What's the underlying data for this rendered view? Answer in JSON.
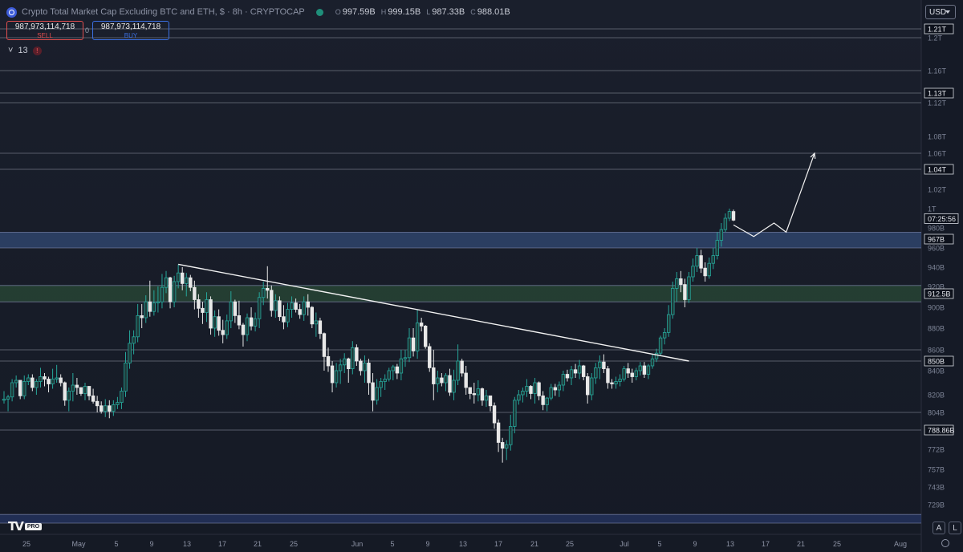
{
  "header": {
    "title": "Crypto Total Market Cap Excluding BTC and ETH, $ · 8h · CRYPTOCAP",
    "ohlc": [
      {
        "label": "O",
        "value": "997.59B"
      },
      {
        "label": "H",
        "value": "999.15B"
      },
      {
        "label": "L",
        "value": "987.33B"
      },
      {
        "label": "C",
        "value": "988.01B"
      }
    ],
    "currency": "USD"
  },
  "trade": {
    "sell_price": "987,973,114,718",
    "sell_label": "SELL",
    "buy_price": "987,973,114,718",
    "buy_label": "BUY",
    "spread": "0"
  },
  "indicator": {
    "count": "13",
    "warn": "!"
  },
  "footer": {
    "logo_text": "PRO",
    "btn_a": "A",
    "btn_l": "L"
  },
  "colors": {
    "up": "#26a69a",
    "down": "#e8e8e8",
    "blue_zone": "#3d5a8f",
    "green_zone": "#2f5a3a",
    "bg": "#151a26"
  },
  "chart_data": {
    "type": "candlestick",
    "ylim_labels": [
      "1.21T",
      "1.2T",
      "1.16T",
      "1.13T",
      "1.12T",
      "1.08T",
      "1.06T",
      "1.04T",
      "1.02T",
      "1T",
      "980B",
      "967B",
      "960B",
      "940B",
      "920B",
      "912.5B",
      "900B",
      "880B",
      "860B",
      "850B",
      "840B",
      "820B",
      "804B",
      "788.86B",
      "772B",
      "757B",
      "743B",
      "729B"
    ],
    "y_ticks": [
      {
        "label": "1.21T",
        "v": 1210,
        "box": true
      },
      {
        "label": "1.2T",
        "v": 1200,
        "box": false
      },
      {
        "label": "1.16T",
        "v": 1160,
        "box": false
      },
      {
        "label": "1.13T",
        "v": 1130,
        "box": true
      },
      {
        "label": "1.12T",
        "v": 1120,
        "box": false
      },
      {
        "label": "1.08T",
        "v": 1080,
        "box": false
      },
      {
        "label": "1.06T",
        "v": 1060,
        "box": false
      },
      {
        "label": "1.04T",
        "v": 1040,
        "box": true
      },
      {
        "label": "1.02T",
        "v": 1020,
        "box": false
      },
      {
        "label": "1T",
        "v": 1000,
        "box": false
      },
      {
        "label": "980B",
        "v": 980,
        "box": false
      },
      {
        "label": "967B",
        "v": 967,
        "box": true
      },
      {
        "label": "960B",
        "v": 960,
        "box": false
      },
      {
        "label": "940B",
        "v": 940,
        "box": false
      },
      {
        "label": "920B",
        "v": 920,
        "box": false
      },
      {
        "label": "912.5B",
        "v": 912.5,
        "box": true
      },
      {
        "label": "900B",
        "v": 900,
        "box": false
      },
      {
        "label": "880B",
        "v": 880,
        "box": false
      },
      {
        "label": "860B",
        "v": 860,
        "box": false
      },
      {
        "label": "850B",
        "v": 850,
        "box": true
      },
      {
        "label": "840B",
        "v": 840,
        "box": false
      },
      {
        "label": "820B",
        "v": 820,
        "box": false
      },
      {
        "label": "804B",
        "v": 804,
        "box": false
      },
      {
        "label": "788.86B",
        "v": 788.86,
        "box": true
      },
      {
        "label": "772B",
        "v": 772,
        "box": false
      },
      {
        "label": "757B",
        "v": 757,
        "box": false
      },
      {
        "label": "743B",
        "v": 743,
        "box": false
      },
      {
        "label": "729B",
        "v": 729,
        "box": false
      }
    ],
    "countdown_label": "07:25:56",
    "x_ticks": [
      "25",
      "May",
      "5",
      "9",
      "13",
      "17",
      "21",
      "25",
      "Jun",
      "5",
      "9",
      "13",
      "17",
      "21",
      "25",
      "Jul",
      "5",
      "9",
      "13",
      "17",
      "21",
      "25",
      "Aug"
    ],
    "horizontal_levels": [
      1210,
      1200,
      1160,
      1130,
      1120,
      1060,
      1040,
      860,
      850,
      804,
      788.86
    ],
    "zones": [
      {
        "name": "blue",
        "from": 960,
        "to": 975,
        "color": "#3d5a8f"
      },
      {
        "name": "green",
        "from": 905,
        "to": 921,
        "color": "#2f5a3a"
      },
      {
        "name": "bottom",
        "from": 712,
        "to": 720,
        "color": "#2b3f7a"
      }
    ],
    "trendline": {
      "from_bar": 43,
      "from_v": 943,
      "to_bar": 169,
      "to_v": 850
    },
    "projection": [
      [
        180,
        983
      ],
      [
        185,
        970
      ],
      [
        190,
        985
      ],
      [
        193,
        975
      ],
      [
        200,
        1060
      ]
    ],
    "candles": [
      [
        0,
        815,
        823,
        812,
        816
      ],
      [
        1,
        816,
        820,
        805,
        818
      ],
      [
        2,
        818,
        833,
        814,
        830
      ],
      [
        3,
        830,
        836,
        826,
        832
      ],
      [
        4,
        832,
        832,
        816,
        819
      ],
      [
        5,
        819,
        836,
        816,
        831
      ],
      [
        6,
        831,
        837,
        828,
        834
      ],
      [
        7,
        834,
        837,
        823,
        826
      ],
      [
        8,
        826,
        833,
        820,
        831
      ],
      [
        9,
        831,
        843,
        826,
        835
      ],
      [
        10,
        835,
        838,
        827,
        833
      ],
      [
        11,
        833,
        835,
        822,
        829
      ],
      [
        12,
        829,
        842,
        825,
        833
      ],
      [
        13,
        833,
        846,
        830,
        834
      ],
      [
        14,
        834,
        837,
        827,
        830
      ],
      [
        15,
        830,
        831,
        810,
        815
      ],
      [
        16,
        815,
        826,
        805,
        823
      ],
      [
        17,
        823,
        838,
        814,
        828
      ],
      [
        18,
        828,
        834,
        820,
        826
      ],
      [
        19,
        826,
        826,
        819,
        821
      ],
      [
        20,
        821,
        830,
        815,
        827
      ],
      [
        21,
        827,
        827,
        815,
        819
      ],
      [
        22,
        819,
        825,
        812,
        814
      ],
      [
        23,
        814,
        819,
        804,
        810
      ],
      [
        24,
        810,
        814,
        803,
        805
      ],
      [
        25,
        805,
        816,
        800,
        810
      ],
      [
        26,
        810,
        815,
        799,
        805
      ],
      [
        27,
        805,
        815,
        801,
        811
      ],
      [
        28,
        811,
        818,
        807,
        813
      ],
      [
        29,
        813,
        826,
        807,
        823
      ],
      [
        30,
        823,
        858,
        818,
        848
      ],
      [
        31,
        848,
        878,
        842,
        866
      ],
      [
        32,
        866,
        878,
        856,
        872
      ],
      [
        33,
        872,
        903,
        867,
        892
      ],
      [
        34,
        892,
        903,
        880,
        890
      ],
      [
        35,
        890,
        911,
        885,
        905
      ],
      [
        36,
        905,
        926,
        891,
        896
      ],
      [
        37,
        896,
        916,
        892,
        904
      ],
      [
        38,
        904,
        920,
        895,
        905
      ],
      [
        39,
        905,
        933,
        899,
        919
      ],
      [
        40,
        919,
        936,
        913,
        929
      ],
      [
        41,
        929,
        930,
        899,
        905
      ],
      [
        42,
        905,
        931,
        900,
        925
      ],
      [
        43,
        925,
        943,
        918,
        934
      ],
      [
        44,
        934,
        940,
        916,
        923
      ],
      [
        45,
        923,
        934,
        910,
        929
      ],
      [
        46,
        929,
        932,
        915,
        919
      ],
      [
        47,
        919,
        926,
        898,
        907
      ],
      [
        48,
        907,
        912,
        890,
        899
      ],
      [
        49,
        899,
        905,
        884,
        895
      ],
      [
        50,
        895,
        914,
        886,
        907
      ],
      [
        51,
        907,
        910,
        874,
        880
      ],
      [
        52,
        880,
        897,
        872,
        891
      ],
      [
        53,
        891,
        898,
        873,
        878
      ],
      [
        54,
        878,
        888,
        866,
        874
      ],
      [
        55,
        874,
        893,
        870,
        887
      ],
      [
        56,
        887,
        915,
        880,
        905
      ],
      [
        57,
        905,
        907,
        885,
        892
      ],
      [
        58,
        892,
        906,
        879,
        883
      ],
      [
        59,
        883,
        885,
        863,
        874
      ],
      [
        60,
        874,
        894,
        868,
        890
      ],
      [
        61,
        890,
        900,
        878,
        882
      ],
      [
        62,
        882,
        895,
        877,
        889
      ],
      [
        63,
        889,
        914,
        880,
        909
      ],
      [
        64,
        909,
        925,
        902,
        918
      ],
      [
        65,
        918,
        941,
        908,
        916
      ],
      [
        66,
        916,
        921,
        891,
        897
      ],
      [
        67,
        897,
        912,
        890,
        906
      ],
      [
        68,
        906,
        910,
        887,
        891
      ],
      [
        69,
        891,
        902,
        879,
        886
      ],
      [
        70,
        886,
        904,
        881,
        898
      ],
      [
        71,
        898,
        910,
        890,
        904
      ],
      [
        72,
        904,
        908,
        895,
        898
      ],
      [
        73,
        898,
        903,
        889,
        893
      ],
      [
        74,
        893,
        910,
        887,
        905
      ],
      [
        75,
        905,
        912,
        892,
        900
      ],
      [
        76,
        900,
        901,
        880,
        884
      ],
      [
        77,
        884,
        895,
        872,
        887
      ],
      [
        78,
        887,
        890,
        870,
        875
      ],
      [
        79,
        875,
        876,
        840,
        854
      ],
      [
        80,
        854,
        862,
        839,
        845
      ],
      [
        81,
        845,
        850,
        822,
        830
      ],
      [
        82,
        830,
        848,
        826,
        840
      ],
      [
        83,
        840,
        852,
        829,
        846
      ],
      [
        84,
        846,
        857,
        838,
        852
      ],
      [
        85,
        852,
        853,
        830,
        842
      ],
      [
        86,
        842,
        868,
        837,
        862
      ],
      [
        87,
        862,
        865,
        845,
        850
      ],
      [
        88,
        850,
        852,
        836,
        840
      ],
      [
        89,
        840,
        855,
        830,
        848
      ],
      [
        90,
        848,
        852,
        820,
        830
      ],
      [
        91,
        830,
        838,
        805,
        815
      ],
      [
        92,
        815,
        833,
        811,
        826
      ],
      [
        93,
        826,
        834,
        818,
        831
      ],
      [
        94,
        831,
        837,
        824,
        833
      ],
      [
        95,
        833,
        843,
        831,
        840
      ],
      [
        96,
        840,
        846,
        832,
        844
      ],
      [
        97,
        844,
        847,
        833,
        838
      ],
      [
        98,
        838,
        860,
        832,
        852
      ],
      [
        99,
        852,
        860,
        844,
        853
      ],
      [
        100,
        853,
        880,
        849,
        871
      ],
      [
        101,
        871,
        880,
        854,
        859
      ],
      [
        102,
        859,
        898,
        852,
        885
      ],
      [
        103,
        885,
        890,
        877,
        882
      ],
      [
        104,
        882,
        883,
        861,
        863
      ],
      [
        105,
        863,
        866,
        839,
        843
      ],
      [
        106,
        843,
        860,
        815,
        829
      ],
      [
        107,
        829,
        840,
        822,
        834
      ],
      [
        108,
        834,
        838,
        827,
        830
      ],
      [
        109,
        830,
        838,
        823,
        836
      ],
      [
        110,
        836,
        842,
        819,
        822
      ],
      [
        111,
        822,
        841,
        815,
        832
      ],
      [
        112,
        832,
        865,
        828,
        850
      ],
      [
        113,
        850,
        852,
        835,
        838
      ],
      [
        114,
        838,
        845,
        820,
        826
      ],
      [
        115,
        826,
        826,
        816,
        821
      ],
      [
        116,
        821,
        830,
        812,
        820
      ],
      [
        117,
        820,
        832,
        814,
        825
      ],
      [
        118,
        825,
        826,
        810,
        815
      ],
      [
        119,
        815,
        824,
        809,
        819
      ],
      [
        120,
        819,
        819,
        805,
        810
      ],
      [
        121,
        810,
        813,
        790,
        795
      ],
      [
        122,
        795,
        798,
        770,
        778
      ],
      [
        123,
        778,
        782,
        762,
        773
      ],
      [
        124,
        773,
        780,
        764,
        776
      ],
      [
        125,
        776,
        802,
        771,
        792
      ],
      [
        126,
        792,
        818,
        786,
        815
      ],
      [
        127,
        815,
        824,
        811,
        820
      ],
      [
        128,
        820,
        826,
        813,
        823
      ],
      [
        129,
        823,
        833,
        818,
        827
      ],
      [
        130,
        827,
        828,
        816,
        821
      ],
      [
        131,
        821,
        834,
        812,
        830
      ],
      [
        132,
        830,
        831,
        815,
        819
      ],
      [
        133,
        819,
        823,
        806,
        811
      ],
      [
        134,
        811,
        818,
        805,
        817
      ],
      [
        135,
        817,
        829,
        815,
        826
      ],
      [
        136,
        826,
        829,
        819,
        824
      ],
      [
        137,
        824,
        831,
        818,
        828
      ],
      [
        138,
        828,
        840,
        823,
        837
      ],
      [
        139,
        837,
        841,
        831,
        834
      ],
      [
        140,
        834,
        845,
        828,
        841
      ],
      [
        141,
        841,
        847,
        834,
        838
      ],
      [
        142,
        838,
        851,
        833,
        845
      ],
      [
        143,
        845,
        846,
        832,
        835
      ],
      [
        144,
        835,
        838,
        812,
        820
      ],
      [
        145,
        820,
        838,
        815,
        834
      ],
      [
        146,
        834,
        848,
        829,
        843
      ],
      [
        147,
        843,
        855,
        833,
        849
      ],
      [
        148,
        849,
        856,
        838,
        842
      ],
      [
        149,
        842,
        845,
        825,
        830
      ],
      [
        150,
        830,
        833,
        825,
        829
      ],
      [
        151,
        829,
        835,
        825,
        831
      ],
      [
        152,
        831,
        837,
        827,
        833
      ],
      [
        153,
        833,
        845,
        831,
        842
      ],
      [
        154,
        842,
        848,
        834,
        838
      ],
      [
        155,
        838,
        842,
        830,
        835
      ],
      [
        156,
        835,
        843,
        832,
        840
      ],
      [
        157,
        840,
        849,
        836,
        845
      ],
      [
        158,
        845,
        849,
        834,
        837
      ],
      [
        159,
        837,
        847,
        833,
        845
      ],
      [
        160,
        845,
        856,
        842,
        852
      ],
      [
        161,
        852,
        861,
        849,
        857
      ],
      [
        162,
        857,
        873,
        855,
        871
      ],
      [
        163,
        871,
        880,
        865,
        876
      ],
      [
        164,
        876,
        902,
        872,
        893
      ],
      [
        165,
        893,
        925,
        889,
        918
      ],
      [
        166,
        918,
        935,
        905,
        928
      ],
      [
        167,
        928,
        936,
        914,
        922
      ],
      [
        168,
        922,
        928,
        900,
        907
      ],
      [
        169,
        907,
        935,
        904,
        930
      ],
      [
        170,
        930,
        949,
        925,
        941
      ],
      [
        171,
        941,
        960,
        935,
        952
      ],
      [
        172,
        952,
        958,
        934,
        939
      ],
      [
        173,
        939,
        945,
        925,
        931
      ],
      [
        174,
        931,
        950,
        928,
        944
      ],
      [
        175,
        944,
        960,
        938,
        952
      ],
      [
        176,
        952,
        975,
        948,
        966
      ],
      [
        177,
        966,
        985,
        961,
        978
      ],
      [
        178,
        978,
        995,
        975,
        990
      ],
      [
        179,
        990,
        1000,
        987,
        997
      ],
      [
        180,
        997,
        999,
        987,
        988
      ]
    ]
  }
}
